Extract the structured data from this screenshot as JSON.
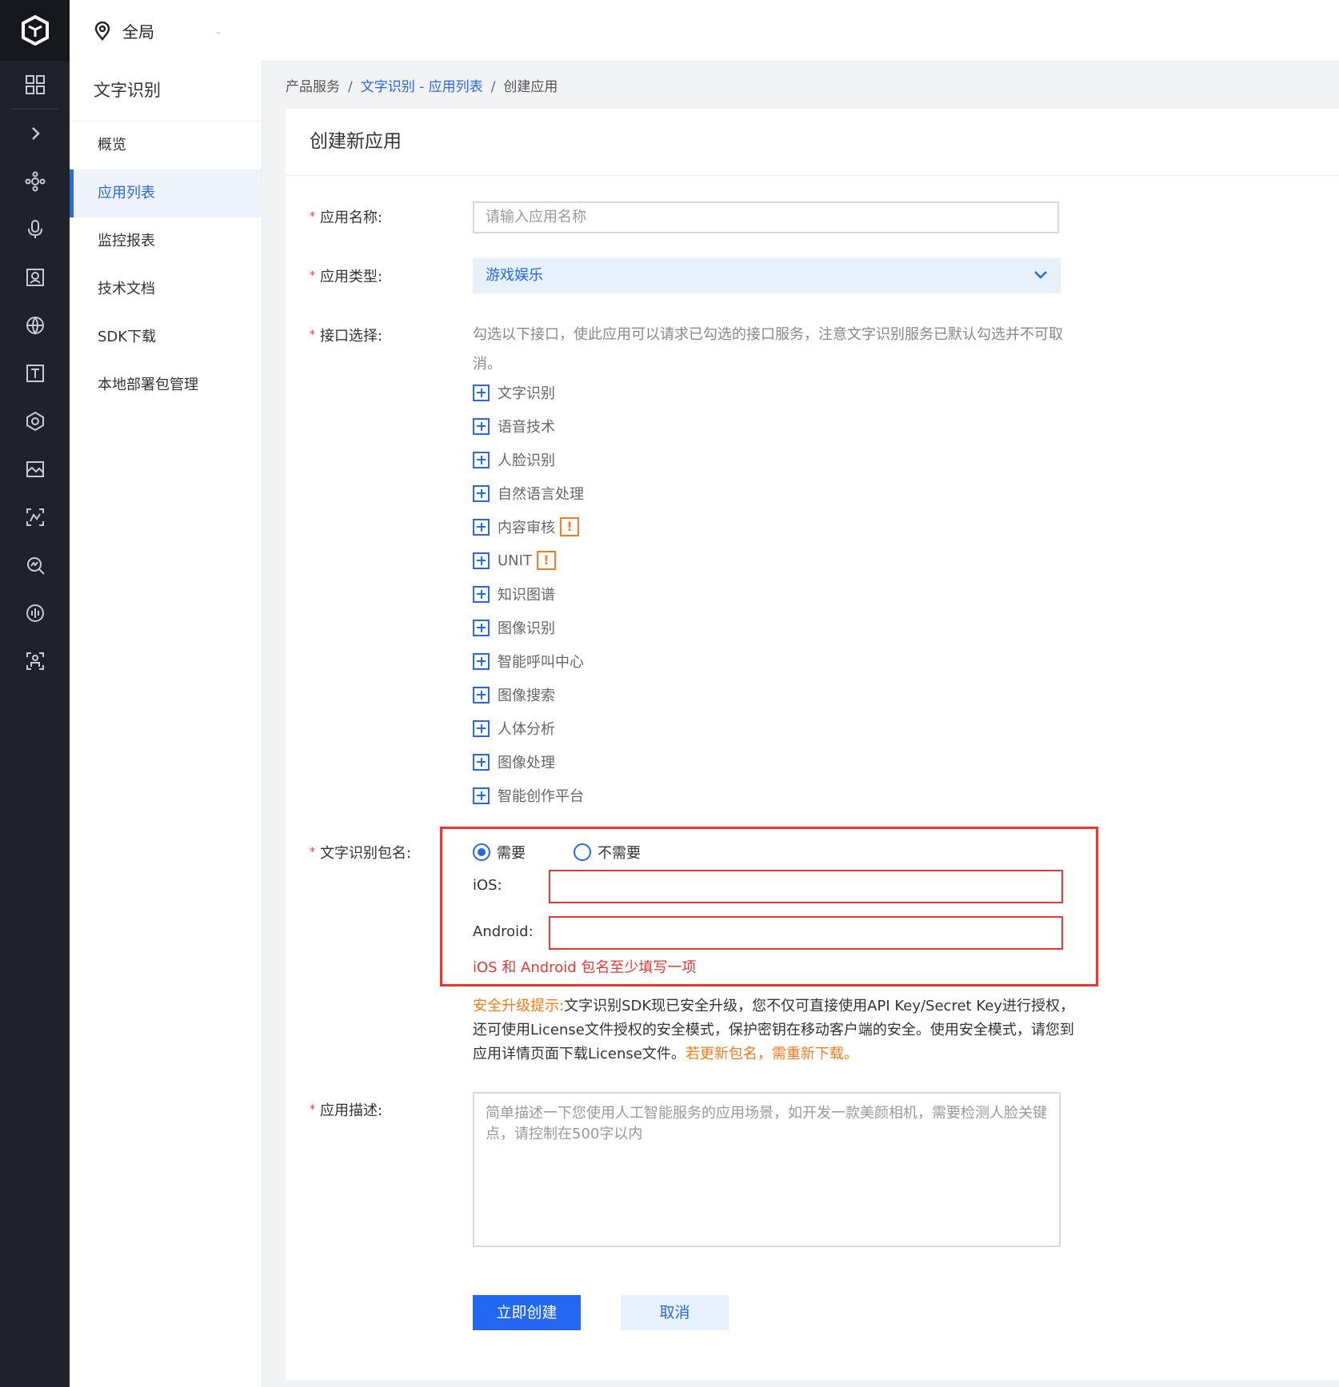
{
  "topbar": {
    "region": "全局"
  },
  "sidebar": {
    "title": "文字识别",
    "items": [
      {
        "label": "概览"
      },
      {
        "label": "应用列表"
      },
      {
        "label": "监控报表"
      },
      {
        "label": "技术文档"
      },
      {
        "label": "SDK下载"
      },
      {
        "label": "本地部署包管理"
      }
    ],
    "active_index": 1
  },
  "breadcrumb": {
    "root": "产品服务",
    "link": "文字识别 - 应用列表",
    "current": "创建应用"
  },
  "form": {
    "title": "创建新应用",
    "name_label": "应用名称:",
    "name_placeholder": "请输入应用名称",
    "type_label": "应用类型:",
    "type_value": "游戏娱乐",
    "api_label": "接口选择:",
    "api_hint": "勾选以下接口，使此应用可以请求已勾选的接口服务，注意文字识别服务已默认勾选并不可取消。",
    "apis": [
      {
        "label": "文字识别",
        "warn": false
      },
      {
        "label": "语音技术",
        "warn": false
      },
      {
        "label": "人脸识别",
        "warn": false
      },
      {
        "label": "自然语言处理",
        "warn": false
      },
      {
        "label": "内容审核",
        "warn": true
      },
      {
        "label": "UNIT",
        "warn": true
      },
      {
        "label": "知识图谱",
        "warn": false
      },
      {
        "label": "图像识别",
        "warn": false
      },
      {
        "label": "智能呼叫中心",
        "warn": false
      },
      {
        "label": "图像搜索",
        "warn": false
      },
      {
        "label": "人体分析",
        "warn": false
      },
      {
        "label": "图像处理",
        "warn": false
      },
      {
        "label": "智能创作平台",
        "warn": false
      }
    ],
    "warn_mark": "!",
    "pkg_label": "文字识别包名:",
    "pkg_option_yes": "需要",
    "pkg_option_no": "不需要",
    "pkg_selected": "需要",
    "ios_label": "iOS:",
    "android_label": "Android:",
    "pkg_error": "iOS 和 Android 包名至少填写一项",
    "notice_prefix": "安全升级提示:",
    "notice_body": "文字识别SDK现已安全升级，您不仅可直接使用API Key/Secret Key进行授权，还可使用License文件授权的安全模式，保护密钥在移动客户端的安全。使用安全模式，请您到应用详情页面下载License文件。",
    "notice_tail": "若更新包名，需重新下载。",
    "desc_label": "应用描述:",
    "desc_placeholder": "简单描述一下您使用人工智能服务的应用场景，如开发一款美颜相机，需要检测人脸关键点，请控制在500字以内",
    "required_mark": "*",
    "submit_label": "立即创建",
    "cancel_label": "取消"
  },
  "colors": {
    "accent": "#2468f2",
    "error": "#e53935",
    "warning": "#ff7a1a",
    "rail": "#1f2229"
  },
  "icons": [
    "logo-icon",
    "grid-icon",
    "chevron-right-icon",
    "network-icon",
    "microphone-icon",
    "face-icon",
    "globe-icon",
    "text-icon",
    "cube-icon",
    "image-icon",
    "scan-icon",
    "search-chart-icon",
    "voice-icon",
    "body-icon",
    "location-pin-icon",
    "chevron-down-icon",
    "plus-box-icon"
  ]
}
